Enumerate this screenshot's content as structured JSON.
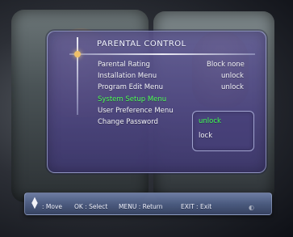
{
  "screen": {
    "title": "PARENTAL CONTROL"
  },
  "menu": {
    "items": [
      {
        "label": "Parental Rating",
        "value": "Block none"
      },
      {
        "label": "Installation Menu",
        "value": "unlock"
      },
      {
        "label": "Program Edit Menu",
        "value": "unlock"
      },
      {
        "label": "System Setup Menu",
        "value": "",
        "active": true
      },
      {
        "label": "User Preference Menu",
        "value": ""
      },
      {
        "label": "Change Password",
        "value": ""
      }
    ]
  },
  "submenu": {
    "options": [
      {
        "label": "unlock",
        "selected": true
      },
      {
        "label": "lock",
        "selected": false
      }
    ]
  },
  "footer": {
    "hints": [
      {
        "label": ": Move"
      },
      {
        "label": "OK : Select"
      },
      {
        "label": "MENU : Return"
      },
      {
        "label": "EXIT : Exit"
      }
    ]
  },
  "colors": {
    "active": "#4cff55",
    "panel": "#5b5296",
    "bar": "#4e5e84"
  },
  "icons": {
    "updown": "updown-arrows-icon",
    "cursor": "cursor-crosshair-icon"
  }
}
